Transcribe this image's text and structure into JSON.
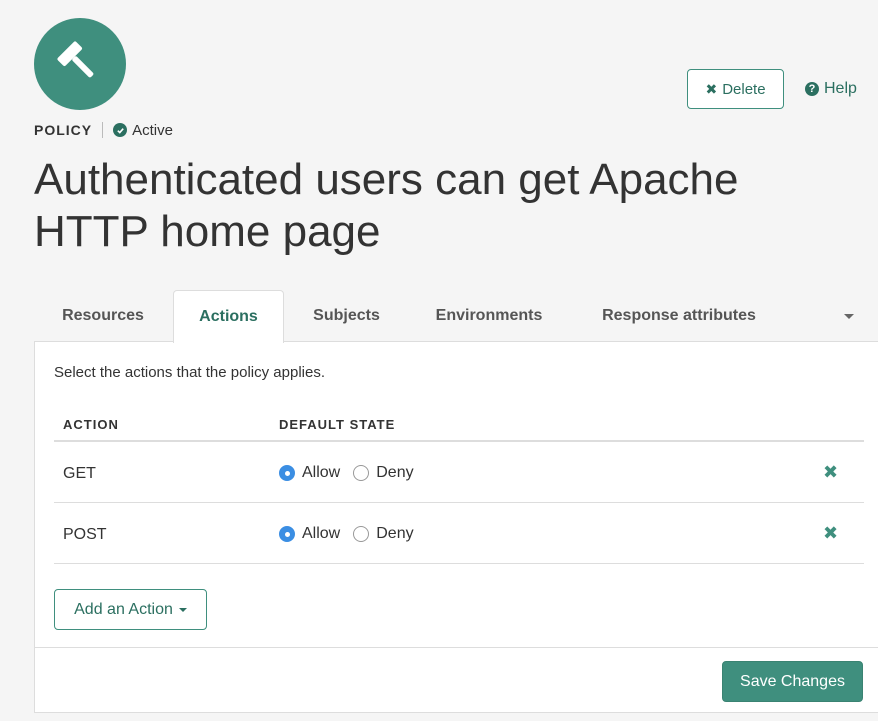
{
  "header": {
    "avatar_icon": "gavel-icon",
    "type_label": "POLICY",
    "status_label": "Active",
    "title": "Authenticated users can get Apache HTTP home page",
    "delete_label": "Delete",
    "help_label": "Help"
  },
  "tabs": [
    {
      "label": "Resources",
      "active": false
    },
    {
      "label": "Actions",
      "active": true
    },
    {
      "label": "Subjects",
      "active": false
    },
    {
      "label": "Environments",
      "active": false
    },
    {
      "label": "Response attributes",
      "active": false
    }
  ],
  "panel": {
    "instructions": "Select the actions that the policy applies.",
    "columns": {
      "action": "ACTION",
      "default_state": "DEFAULT STATE"
    },
    "rows": [
      {
        "action": "GET",
        "allow_label": "Allow",
        "deny_label": "Deny",
        "selected": "Allow"
      },
      {
        "action": "POST",
        "allow_label": "Allow",
        "deny_label": "Deny",
        "selected": "Allow"
      }
    ],
    "add_action_label": "Add an Action",
    "save_label": "Save Changes"
  },
  "colors": {
    "accent": "#3f8f7e",
    "accent_dark": "#2b6f60",
    "radio_selected": "#3b8ee3"
  }
}
